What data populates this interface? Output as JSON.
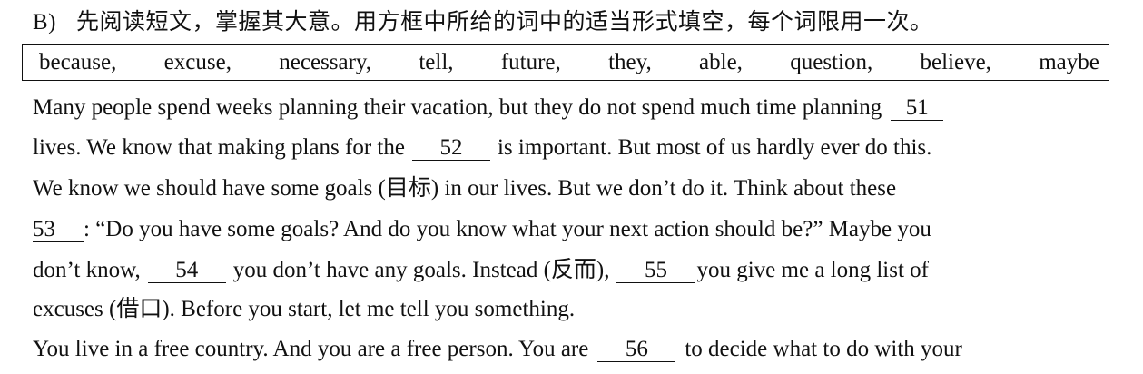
{
  "heading": {
    "section": "B)",
    "instruction": "先阅读短文，掌握其大意。用方框中所给的词中的适当形式填空，每个词限用一次。"
  },
  "word_box": [
    "because,",
    "excuse,",
    "necessary,",
    "tell,",
    "future,",
    "they,",
    "able,",
    "question,",
    "believe,",
    "maybe"
  ],
  "passage": {
    "l1_text": "Many people spend weeks planning their vacation, but they do not spend much time planning",
    "blank_51": "51",
    "l2_a": "lives. We know that making plans for the",
    "blank_52": "52",
    "l2_b": "is important. But most of us hardly ever do this.",
    "l3_text": "We know we should have some goals (目标) in our lives. But we don’t do it. Think about these",
    "blank_53": "53",
    "l4_text": ": “Do you have some goals? And do you know what your next action should be?” Maybe you",
    "l5_a": "don’t know,",
    "blank_54": "54",
    "l5_b": "you don’t have any goals. Instead (反而),",
    "blank_55": "55",
    "l5_c": "you give me a long list of",
    "l6_text": "excuses (借口). Before you start, let me tell you something.",
    "l7_a": "You live in a free country. And you are a free person. You are",
    "blank_56": "56",
    "l7_b": "to decide what to do with your"
  }
}
